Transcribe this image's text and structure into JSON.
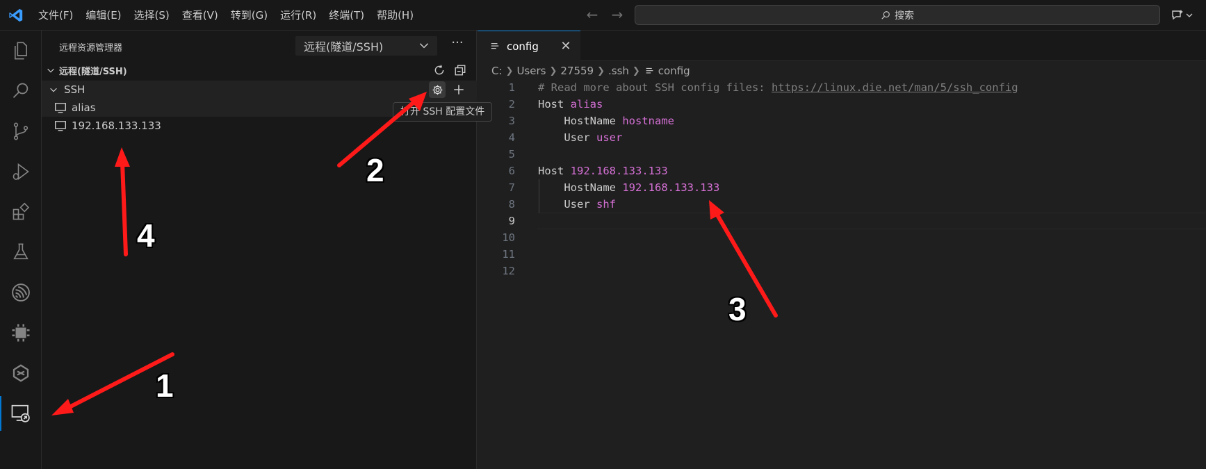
{
  "menu": {
    "items": [
      "文件(F)",
      "编辑(E)",
      "选择(S)",
      "查看(V)",
      "转到(G)",
      "运行(R)",
      "终端(T)",
      "帮助(H)"
    ]
  },
  "search": {
    "label": "搜索"
  },
  "sidebar": {
    "title": "远程资源管理器",
    "dropdown_value": "远程(隧道/SSH)",
    "section_title": "远程(隧道/SSH)",
    "group_label": "SSH",
    "hosts": [
      "alias",
      "192.168.133.133"
    ],
    "tooltip": "打开 SSH 配置文件"
  },
  "editor": {
    "tab_label": "config",
    "breadcrumb": [
      "C:",
      "Users",
      "27559",
      ".ssh",
      "config"
    ],
    "line_numbers": [
      "1",
      "2",
      "3",
      "4",
      "5",
      "6",
      "7",
      "8",
      "9",
      "10",
      "11",
      "12"
    ],
    "lines": {
      "l1_comment": "# Read more about SSH config files: ",
      "l1_link": "https://linux.die.net/man/5/ssh_config",
      "l2_key": "Host ",
      "l2_val": "alias",
      "l3_key": "    HostName ",
      "l3_val": "hostname",
      "l4_key": "    User ",
      "l4_val": "user",
      "l6_key": "Host ",
      "l6_val": "192.168.133.133",
      "l7_key": "    HostName ",
      "l7_val": "192.168.133.133",
      "l8_key": "    User ",
      "l8_val": "shf"
    }
  },
  "annotations": {
    "n1": "1",
    "n2": "2",
    "n3": "3",
    "n4": "4",
    "arrow_color": "#ff1a1a"
  },
  "colors": {
    "accent": "#0078d4",
    "value": "#d670d6"
  },
  "icons": {
    "activity": [
      "explorer-icon",
      "search-icon",
      "source-control-icon",
      "run-debug-icon",
      "extensions-icon",
      "testing-icon",
      "esp-idf-icon",
      "chip-icon",
      "platform-icon",
      "remote-explorer-icon"
    ]
  }
}
